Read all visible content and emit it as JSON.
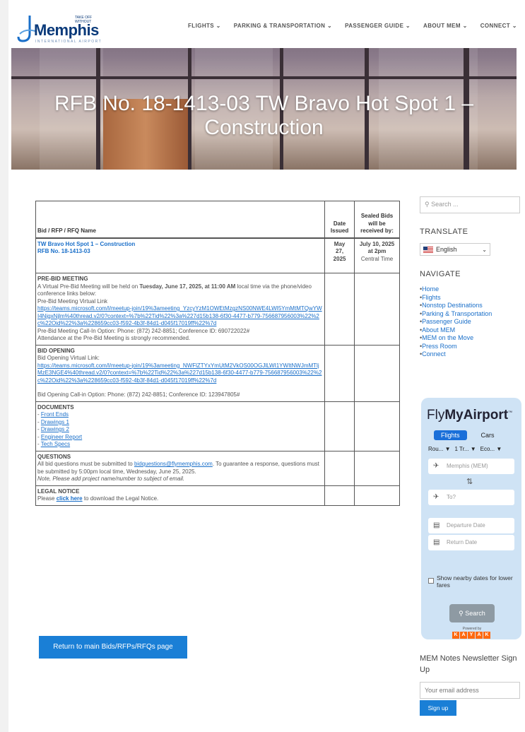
{
  "header": {
    "logo_name": "Memphis",
    "logo_tagline": "TAKE OFF WITHOUT",
    "logo_sub": "INTERNATIONAL AIRPORT",
    "nav": [
      "FLIGHTS",
      "PARKING & TRANSPORTATION",
      "PASSENGER GUIDE",
      "ABOUT MEM",
      "CONNECT"
    ]
  },
  "hero": {
    "title_line1": "RFB No. 18-1413-03 TW Bravo Hot Spot 1 –",
    "title_line2": "Construction"
  },
  "table": {
    "headers": [
      "Bid / RFP / RFQ Name",
      "Date Issued",
      "Sealed Bids will be received by:"
    ],
    "row1": {
      "name_line1": "TW Bravo Hot Spot 1 – Construction",
      "name_line2": "RFB No. 18-1413-03",
      "date": [
        "May",
        "27,",
        "2025"
      ],
      "sealed": [
        "July 10, 2025",
        "at 2pm",
        "Central Time"
      ]
    },
    "prebid": {
      "heading": "PRE-BID MEETING",
      "text_a": "A Virtual Pre-Bid Meeting will be held on ",
      "text_bold": "Tuesday, June 17, 2025, at 11:00 AM",
      "text_b": " local time via the phone/video conference links below:",
      "link_label": "Pre-Bid Meeting Virtual Link",
      "link": "https://teams.microsoft.com/l/meetup-join/19%3ameeting_YzcyYzM1OWEtMzgzNS00NWE4LWI5YmMtMTQwYWI4NjgxNjlm%40thread.v2/0?context=%7b%22Tid%22%3a%227d15b138-6f30-4477-b779-756687956003%22%2c%22Oid%22%3a%228659cc03-f592-4b3f-84d1-d045f17019ff%22%7d",
      "callin": "Pre-Bid Meeting Call-In Option: Phone: (872) 242-8851; Conference ID: 690722022#",
      "note": "Attendance at the Pre-Bid Meeting is strongly recommended."
    },
    "opening": {
      "heading": "BID OPENING",
      "label": "Bid Opening Virtual Link:",
      "link": "https://teams.microsoft.com/l/meetup-join/19%3ameeting_NWFlZTYxYmUtM2VkOS00OGJlLWI1YWItNWJmMTljMzE3NGE4%40thread.v2/0?context=%7b%22Tid%22%3a%227d15b138-6f30-4477-b779-756687956003%22%2c%22Oid%22%3a%228659cc03-f592-4b3f-84d1-d045f17019ff%22%7d",
      "callin": "Bid Opening Call-in Option: Phone: (872) 242-8851; Conference ID: 123947805#"
    },
    "documents": {
      "heading": "DOCUMENTS",
      "items": [
        "Front Ends",
        "Drawings 1",
        "Drawings 2",
        "Engineer Report",
        "Tech Specs"
      ]
    },
    "questions": {
      "heading": "QUESTIONS",
      "text_a": "All bid questions must be submitted to ",
      "email": "bidquestions@flymemphis.com",
      "text_b": ". To guarantee a response, questions must be submitted by 5:00pm local time, Wednesday, June 25, 2025.",
      "note": "Note, Please add project name/number to subject of email."
    },
    "legal": {
      "heading": "LEGAL NOTICE",
      "text_a": "Please ",
      "link": "click here",
      "text_b": " to download the Legal Notice."
    }
  },
  "return_button": "Return to main Bids/RFPs/RFQs page",
  "sidebar": {
    "search_placeholder": "Search ...",
    "translate_heading": "TRANSLATE",
    "language": "English",
    "navigate_heading": "NAVIGATE",
    "nav_items": [
      "Home",
      "Flights",
      "Nonstop Destinations",
      "Parking & Transportation",
      "Passenger Guide",
      "About MEM",
      "MEM on the Move",
      "Press Room",
      "Connect"
    ],
    "widget": {
      "brand_a": "Fly",
      "brand_b": "MyAirport",
      "tm": "™",
      "tab_flights": "Flights",
      "tab_cars": "Cars",
      "opt1": "Rou...",
      "opt2": "1 Tr...",
      "opt3": "Eco...",
      "from": "Memphis (MEM)",
      "to": "To?",
      "depart": "Departure Date",
      "return": "Return Date",
      "nearby": "Show nearby dates for lower fares",
      "search": "Search",
      "powered": "Powered by",
      "kayak": [
        "K",
        "A",
        "Y",
        "A",
        "K"
      ]
    },
    "newsletter_heading": "MEM Notes Newsletter Sign Up",
    "email_placeholder": "Your email address",
    "signup": "Sign up"
  }
}
